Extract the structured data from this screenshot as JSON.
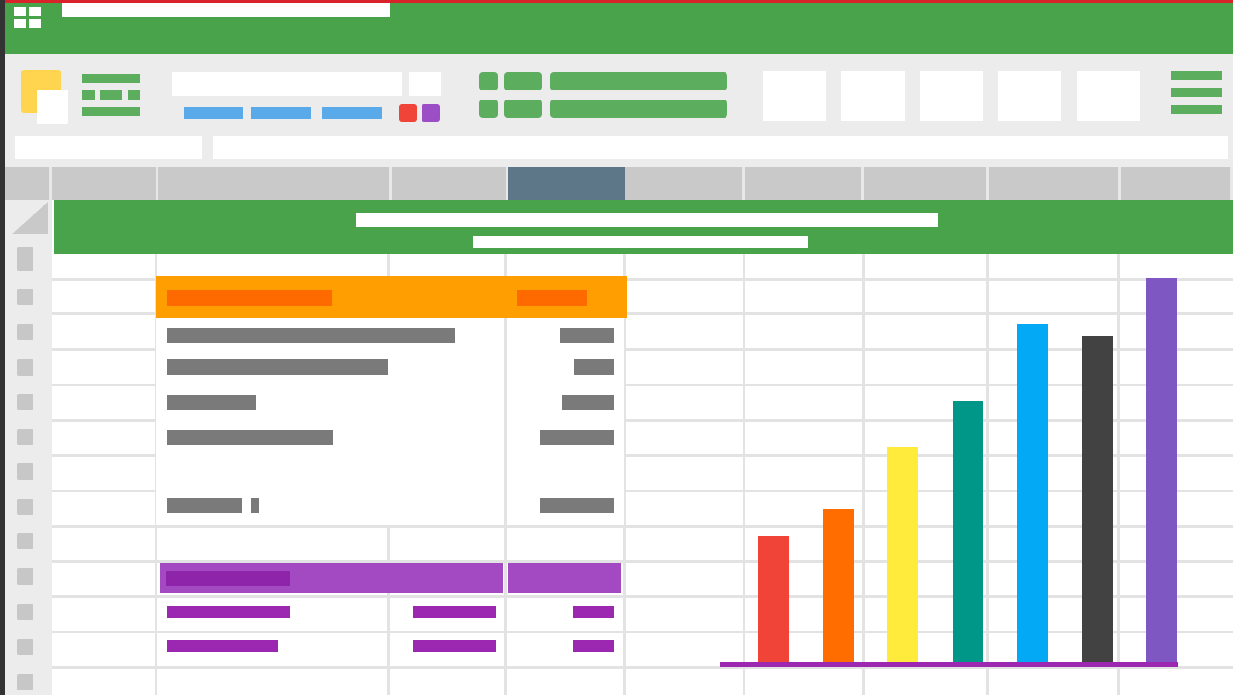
{
  "app": {
    "title": "",
    "formula_cell_ref": "",
    "formula_value": ""
  },
  "sheet": {
    "title": "",
    "subtitle": "",
    "selected_column_index": 4
  },
  "colors": {
    "accent": "#49a34a",
    "frame_red": "#d9232a",
    "header_orange": "#ff9e00",
    "orange_text": "#ff6a00",
    "purple": "#9c27b0",
    "purple_header": "#a349c1",
    "selected_col": "#5d7788"
  },
  "chart_data": {
    "type": "bar",
    "categories": [
      "",
      "",
      "",
      "",
      "",
      "",
      ""
    ],
    "values": [
      33,
      40,
      56,
      68,
      88,
      85,
      100
    ],
    "colors": [
      "#f04438",
      "#ff6d00",
      "#ffeb3b",
      "#009688",
      "#03a9f4",
      "#424242",
      "#7e57c2"
    ],
    "ylim": [
      0,
      100
    ],
    "title": "",
    "xlabel": "",
    "ylabel": ""
  }
}
